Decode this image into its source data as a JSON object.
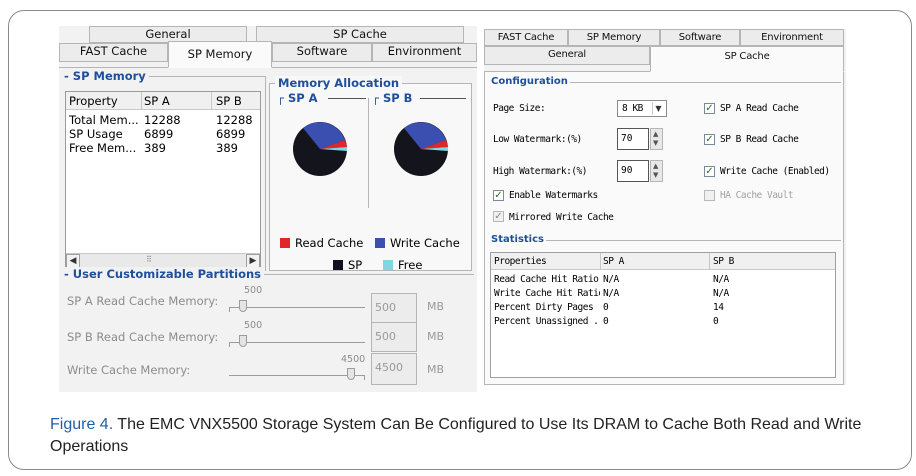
{
  "left_dialog": {
    "tabs_row1": [
      "General",
      "SP Cache"
    ],
    "tabs_row2": [
      "FAST Cache",
      "SP Memory",
      "Software",
      "Environment"
    ],
    "sp_memory": {
      "title": "SP Memory",
      "columns": [
        "Property",
        "SP A",
        "SP B"
      ],
      "rows": [
        [
          "Total Mem...",
          "12288",
          "12288"
        ],
        [
          "SP Usage",
          "6899",
          "6899"
        ],
        [
          "Free Mem...",
          "389",
          "389"
        ]
      ],
      "scroll_thumb": "⠿"
    },
    "memory_allocation": {
      "title": "Memory Allocation",
      "sp_a": "SP A",
      "sp_b": "SP B",
      "legend": [
        {
          "label": "Read Cache",
          "color": "#e0262b"
        },
        {
          "label": "Write Cache",
          "color": "#3a4fb0"
        },
        {
          "label": "SP",
          "color": "#111122"
        },
        {
          "label": "Free",
          "color": "#7fd6e0"
        }
      ]
    },
    "partitions": {
      "title": "User Customizable Partitions",
      "unit": "MB",
      "rows": [
        {
          "label": "SP A Read Cache Memory:",
          "tick_value": "500",
          "value": "500",
          "level": 0.1
        },
        {
          "label": "SP B Read Cache Memory:",
          "tick_value": "500",
          "value": "500",
          "level": 0.1
        },
        {
          "label": "Write Cache Memory:",
          "tick_value": "4500",
          "value": "4500",
          "level": 0.9
        }
      ]
    }
  },
  "right_dialog": {
    "tabs_row1": [
      "FAST Cache",
      "SP Memory",
      "Software",
      "Environment"
    ],
    "tabs_row2": [
      "General",
      "SP Cache"
    ],
    "configuration": {
      "title": "Configuration",
      "page_size_label": "Page Size:",
      "page_size_value": "8 KB",
      "low_watermark_label": "Low Watermark:(%)",
      "low_watermark_value": "70",
      "high_watermark_label": "High Watermark:(%)",
      "high_watermark_value": "90",
      "checkboxes": {
        "sp_a_read": "SP A Read Cache",
        "sp_b_read": "SP B Read Cache",
        "write_cache": "Write Cache (Enabled)",
        "enable_watermarks": "Enable Watermarks",
        "ha_cache_vault": "HA Cache Vault",
        "mirrored_write": "Mirrored Write Cache"
      }
    },
    "statistics": {
      "title": "Statistics",
      "columns": [
        "Properties",
        "SP A",
        "SP B"
      ],
      "rows": [
        [
          "Read Cache Hit Ratio",
          "N/A",
          "N/A"
        ],
        [
          "Write Cache Hit Ratio",
          "N/A",
          "N/A"
        ],
        [
          "Percent Dirty Pages",
          "0",
          "14"
        ],
        [
          "Percent Unassigned ...",
          "0",
          "0"
        ]
      ]
    }
  },
  "caption": {
    "label": "Figure 4.",
    "text": " The EMC VNX5500 Storage System Can Be Configured to Use Its DRAM to Cache Both Read and Write Operations"
  }
}
